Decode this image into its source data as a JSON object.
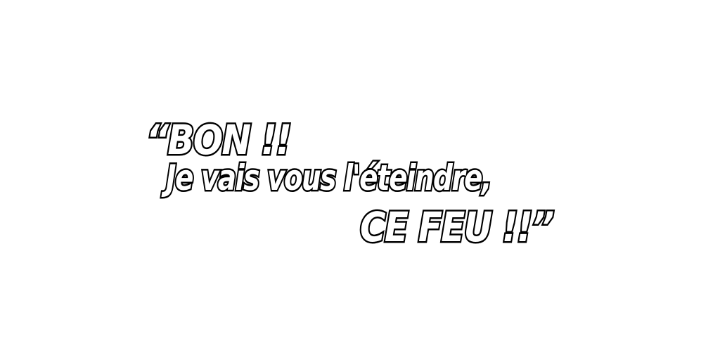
{
  "speech": {
    "line_1": "“BON !!",
    "line_2": "Je vais vous l'éteindre,",
    "line_3": "CE FEU !!”"
  },
  "colors": {
    "background": "#ffffff",
    "text_fill": "#ffffff",
    "text_outline": "#000000"
  }
}
